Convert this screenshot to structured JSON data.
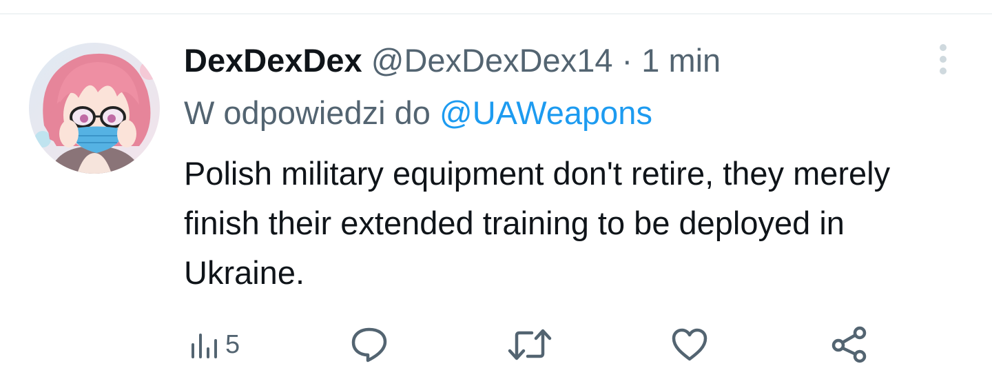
{
  "tweet": {
    "display_name": "DexDexDex",
    "handle": "@DexDexDex14",
    "separator": "·",
    "time": "1 min",
    "reply_prefix": "W odpowiedzi do",
    "reply_to": "@UAWeapons",
    "text": "Polish military equipment don't retire, they merely finish their extended training to be deployed in Ukraine.",
    "avatar_icon": "anime-avatar-icon"
  },
  "actions": {
    "views_count": "5",
    "views_icon": "views-icon",
    "reply_icon": "reply-icon",
    "retweet_icon": "retweet-icon",
    "like_icon": "like-icon",
    "share_icon": "share-icon",
    "more_icon": "more-options-icon"
  },
  "colors": {
    "text_primary": "#0f1419",
    "text_secondary": "#536471",
    "link": "#1d9bf0",
    "divider": "#eff3f4",
    "icon": "#536471"
  }
}
